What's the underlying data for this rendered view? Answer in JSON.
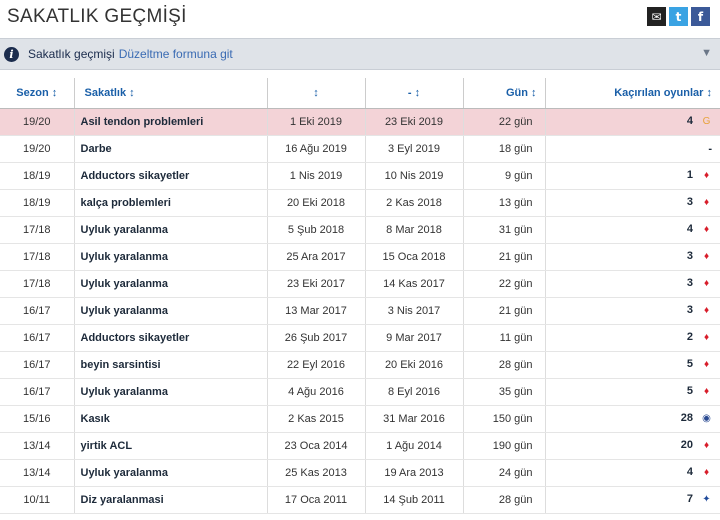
{
  "header": {
    "title": "SAKATLIK GEÇMİŞİ"
  },
  "share": {
    "mail": "✉",
    "twitter": "t",
    "facebook": "f"
  },
  "info": {
    "text": "Sakatlık geçmişi",
    "link": "Düzeltme formuna git"
  },
  "columns": {
    "season": "Sezon ↕",
    "injury": "Sakatlık ↕",
    "from": "↕",
    "until": "- ↕",
    "days": "Gün ↕",
    "games": "Kaçırılan oyunlar ↕"
  },
  "rows": [
    {
      "season": "19/20",
      "injury": "Asil tendon problemleri",
      "from": "1 Eki 2019",
      "until": "23 Eki 2019",
      "days": "22 gün",
      "games": "4",
      "club_icon": "galatasaray-crest-icon"
    },
    {
      "season": "19/20",
      "injury": "Darbe",
      "from": "16 Ağu 2019",
      "until": "3 Eyl 2019",
      "days": "18 gün",
      "games": "-",
      "club_icon": ""
    },
    {
      "season": "18/19",
      "injury": "Adductors sikayetler",
      "from": "1 Nis 2019",
      "until": "10 Nis 2019",
      "days": "9 gün",
      "games": "1",
      "club_icon": "monaco-crest-icon"
    },
    {
      "season": "18/19",
      "injury": "kalça problemleri",
      "from": "20 Eki 2018",
      "until": "2 Kas 2018",
      "days": "13 gün",
      "games": "3",
      "club_icon": "monaco-crest-icon"
    },
    {
      "season": "17/18",
      "injury": "Uyluk yaralanma",
      "from": "5 Şub 2018",
      "until": "8 Mar 2018",
      "days": "31 gün",
      "games": "4",
      "club_icon": "monaco-crest-icon"
    },
    {
      "season": "17/18",
      "injury": "Uyluk yaralanma",
      "from": "25 Ara 2017",
      "until": "15 Oca 2018",
      "days": "21 gün",
      "games": "3",
      "club_icon": "monaco-crest-icon"
    },
    {
      "season": "17/18",
      "injury": "Uyluk yaralanma",
      "from": "23 Eki 2017",
      "until": "14 Kas 2017",
      "days": "22 gün",
      "games": "3",
      "club_icon": "monaco-crest-icon"
    },
    {
      "season": "16/17",
      "injury": "Uyluk yaralanma",
      "from": "13 Mar 2017",
      "until": "3 Nis 2017",
      "days": "21 gün",
      "games": "3",
      "club_icon": "monaco-crest-icon"
    },
    {
      "season": "16/17",
      "injury": "Adductors sikayetler",
      "from": "26 Şub 2017",
      "until": "9 Mar 2017",
      "days": "11 gün",
      "games": "2",
      "club_icon": "monaco-crest-icon"
    },
    {
      "season": "16/17",
      "injury": "beyin sarsintisi",
      "from": "22 Eyl 2016",
      "until": "20 Eki 2016",
      "days": "28 gün",
      "games": "5",
      "club_icon": "monaco-crest-icon"
    },
    {
      "season": "16/17",
      "injury": "Uyluk yaralanma",
      "from": "4 Ağu 2016",
      "until": "8 Eyl 2016",
      "days": "35 gün",
      "games": "5",
      "club_icon": "monaco-crest-icon"
    },
    {
      "season": "15/16",
      "injury": "Kasık",
      "from": "2 Kas 2015",
      "until": "31 Mar 2016",
      "days": "150 gün",
      "games": "28",
      "club_icon": "realmadrid-crest-icon"
    },
    {
      "season": "13/14",
      "injury": "yirtik ACL",
      "from": "23 Oca 2014",
      "until": "1 Ağu 2014",
      "days": "190 gün",
      "games": "20",
      "club_icon": "monaco-crest-icon"
    },
    {
      "season": "13/14",
      "injury": "Uyluk yaralanma",
      "from": "25 Kas 2013",
      "until": "19 Ara 2013",
      "days": "24 gün",
      "games": "4",
      "club_icon": "monaco-crest-icon"
    },
    {
      "season": "10/11",
      "injury": "Diz yaralanmasi",
      "from": "17 Oca 2011",
      "until": "14 Şub 2011",
      "days": "28 gün",
      "games": "7",
      "club_icon": "porto-crest-icon"
    }
  ],
  "colors": {
    "highlight_row": "#f3d3d7",
    "header_link": "#1a5fa8",
    "info_bar": "#dfe3e8"
  }
}
